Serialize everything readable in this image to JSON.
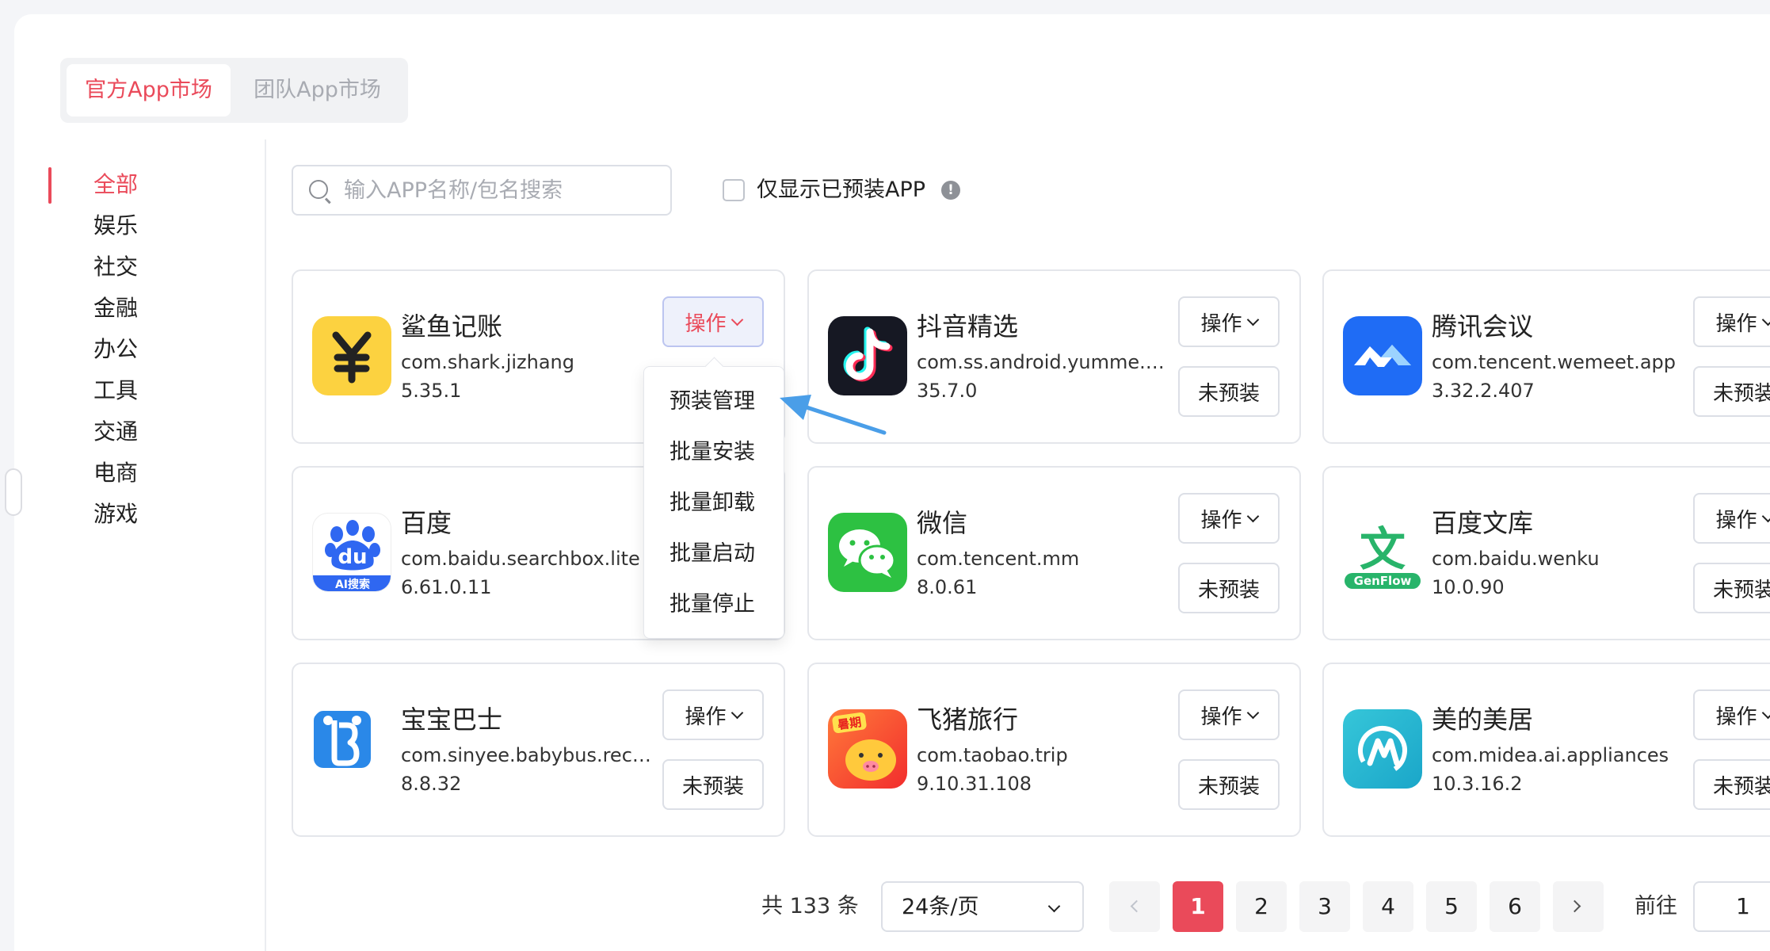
{
  "market_tabs": {
    "official": "官方App市场",
    "team": "团队App市场"
  },
  "categories": [
    "全部",
    "娱乐",
    "社交",
    "金融",
    "办公",
    "工具",
    "交通",
    "电商",
    "游戏"
  ],
  "active_category": "全部",
  "search": {
    "placeholder": "输入APP名称/包名搜索",
    "value": ""
  },
  "filter": {
    "label": "仅显示已预装APP",
    "checked": false,
    "info_icon": "info-circle-icon"
  },
  "apps": [
    {
      "name": "鲨鱼记账",
      "package": "com.shark.jizhang",
      "version": "5.35.1",
      "icon": "shark-jizhang-icon"
    },
    {
      "name": "抖音精选",
      "package": "com.ss.android.yumme.vid...",
      "version": "35.7.0",
      "icon": "douyin-icon",
      "status": "未预装"
    },
    {
      "name": "腾讯会议",
      "package": "com.tencent.wemeet.app",
      "version": "3.32.2.407",
      "icon": "tencent-meeting-icon",
      "status": "未预装"
    },
    {
      "name": "百度",
      "package": "com.baidu.searchbox.lite",
      "version": "6.61.0.11",
      "icon": "baidu-icon",
      "icon_text": "du",
      "icon_badge": "AI搜索"
    },
    {
      "name": "微信",
      "package": "com.tencent.mm",
      "version": "8.0.61",
      "icon": "wechat-icon",
      "status": "未预装"
    },
    {
      "name": "百度文库",
      "package": "com.baidu.wenku",
      "version": "10.0.90",
      "icon": "baidu-wenku-icon",
      "icon_text": "文",
      "icon_badge": "GenFlow",
      "status": "未预装"
    },
    {
      "name": "宝宝巴士",
      "package": "com.sinyee.babybus.reco...",
      "version": "8.8.32",
      "icon": "babybus-icon",
      "status": "未预装"
    },
    {
      "name": "飞猪旅行",
      "package": "com.taobao.trip",
      "version": "9.10.31.108",
      "icon": "fliggy-icon",
      "icon_badge": "暑期",
      "status": "未预装"
    },
    {
      "name": "美的美居",
      "package": "com.midea.ai.appliances",
      "version": "10.3.16.2",
      "icon": "midea-meiju-icon",
      "status": "未预装"
    }
  ],
  "operate_label": "操作",
  "dropdown_items": [
    "预装管理",
    "批量安装",
    "批量卸载",
    "批量启动",
    "批量停止"
  ],
  "pagination": {
    "total": "共 133 条",
    "page_size": "24条/页",
    "pages": [
      "1",
      "2",
      "3",
      "4",
      "5",
      "6"
    ],
    "current_page": "1",
    "goto_label": "前往",
    "goto_value": "1"
  },
  "colors": {
    "accent": "#ea4a5a",
    "annotation_arrow": "#4a9ee8"
  }
}
